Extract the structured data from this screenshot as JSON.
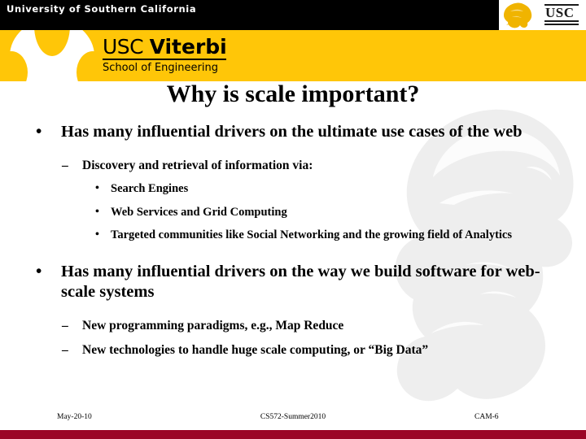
{
  "header": {
    "university_label": "University of Southern California",
    "usc_monogram": "USC",
    "trojan_icon": "trojan-head-icon",
    "brand": {
      "line1_prefix": "USC ",
      "line1_bold": "Viterbi",
      "line2": "School of Engineering"
    }
  },
  "colors": {
    "header_black": "#000000",
    "header_gold": "#ffc608",
    "bottom_bar_crimson": "#9b0626",
    "text_black": "#000000",
    "background": "#ffffff"
  },
  "watermark": {
    "icon": "trojan-head-watermark",
    "opacity": "0.30"
  },
  "slide": {
    "title": "Why is scale important?",
    "bullets": [
      {
        "level": 1,
        "marker": "•",
        "text": "Has many influential drivers on the ultimate use cases of the web"
      },
      {
        "level": 2,
        "marker": "–",
        "text": "Discovery and retrieval of information via:"
      },
      {
        "level": 3,
        "marker": "•",
        "text": "Search Engines"
      },
      {
        "level": 3,
        "marker": "•",
        "text": "Web Services and Grid Computing"
      },
      {
        "level": 3,
        "marker": "•",
        "text": "Targeted communities like Social Networking and the growing field of Analytics"
      },
      {
        "level": 1,
        "marker": "•",
        "text": "Has many influential drivers on the way we build software for web-scale systems"
      },
      {
        "level": 2,
        "marker": "–",
        "text": "New programming paradigms, e.g., Map Reduce"
      },
      {
        "level": 2,
        "marker": "–",
        "text": "New technologies to handle huge scale computing, or “Big Data”"
      }
    ]
  },
  "footer": {
    "date": "May-20-10",
    "course": "CS572-Summer2010",
    "code": "CAM-6"
  }
}
